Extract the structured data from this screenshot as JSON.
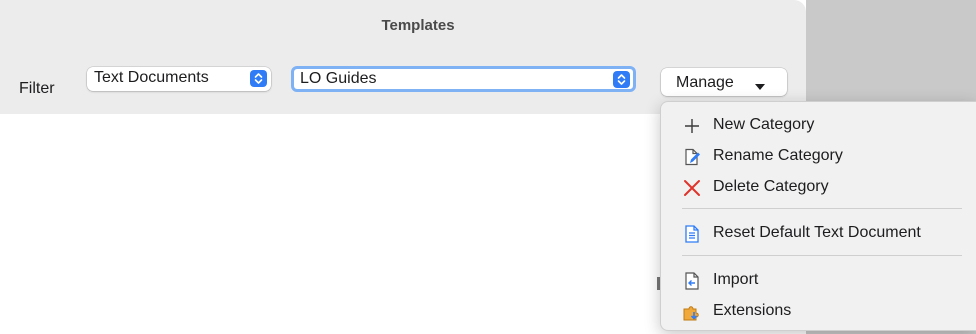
{
  "dialog": {
    "title": "Templates"
  },
  "filter": {
    "label": "Filter",
    "type_select": "Text Documents",
    "category_combo": "LO Guides"
  },
  "manage": {
    "label": "Manage"
  },
  "menu": {
    "items": [
      {
        "label": "New Category",
        "icon": "plus-icon"
      },
      {
        "label": "Rename Category",
        "icon": "rename-icon"
      },
      {
        "label": "Delete Category",
        "icon": "delete-x-icon"
      },
      {
        "label": "Reset Default Text Document",
        "icon": "document-icon"
      },
      {
        "label": "Import",
        "icon": "import-icon"
      },
      {
        "label": "Extensions",
        "icon": "extensions-icon"
      }
    ]
  },
  "colors": {
    "accent": "#2f7cf6",
    "delete_red": "#e0332b",
    "focus_ring": "#7fb1f5"
  }
}
